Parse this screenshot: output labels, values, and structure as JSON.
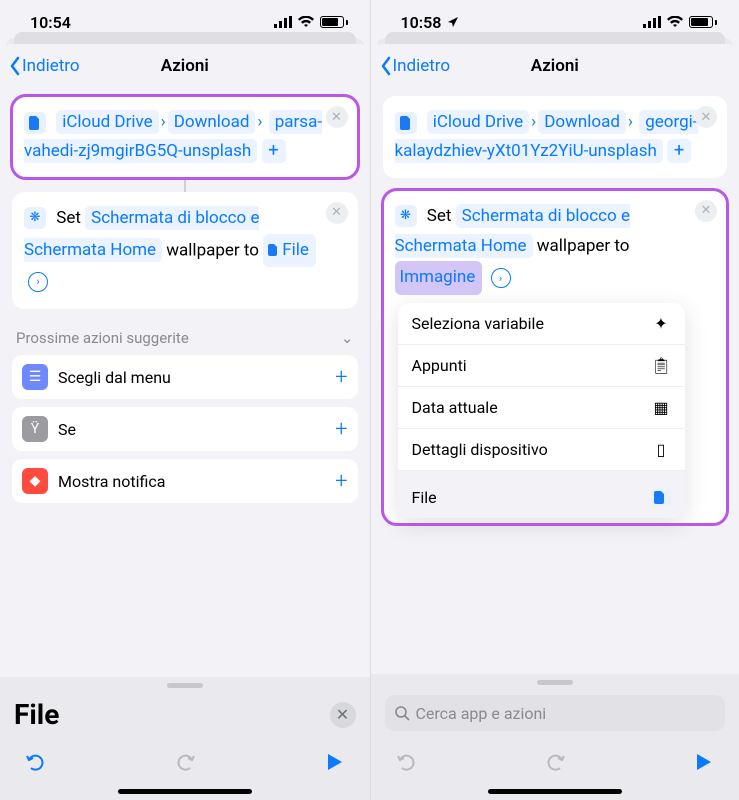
{
  "left": {
    "status": {
      "time": "10:54",
      "battery": "75"
    },
    "nav": {
      "back": "Indietro",
      "title": "Azioni"
    },
    "file_card": {
      "drive": "iCloud Drive",
      "folder": "Download",
      "filename": "parsa-vahedi-zj9mgirBG5Q-unsplash"
    },
    "set_card": {
      "set_word": "Set",
      "target": "Schermata di blocco e Schermata Home",
      "wallpaper_to": "wallpaper to",
      "param_label": "File"
    },
    "suggestions": {
      "header": "Prossime azioni suggerite",
      "items": [
        {
          "label": "Scegli dal menu",
          "color": "#6f87ff",
          "glyph": "☰"
        },
        {
          "label": "Se",
          "color": "#9b9ba0",
          "glyph": "⑂"
        },
        {
          "label": "Mostra notifica",
          "color": "#ff4b3e",
          "glyph": "🔔"
        }
      ]
    },
    "bottom": {
      "big_label": "File"
    }
  },
  "right": {
    "status": {
      "time": "10:58",
      "battery": "74"
    },
    "nav": {
      "back": "Indietro",
      "title": "Azioni"
    },
    "file_card": {
      "drive": "iCloud Drive",
      "folder": "Download",
      "filename": "georgi-kalaydzhiev-yXt01Yz2YiU-unsplash"
    },
    "set_card": {
      "set_word": "Set",
      "target": "Schermata di blocco e Schermata Home",
      "wallpaper_to": "wallpaper to",
      "param_label": "Immagine"
    },
    "popover": {
      "rows": [
        {
          "label": "Seleziona variabile",
          "icon": "wand"
        },
        {
          "label": "Appunti",
          "icon": "clipboard"
        },
        {
          "label": "Data attuale",
          "icon": "calendar"
        },
        {
          "label": "Dettagli dispositivo",
          "icon": "phone"
        },
        {
          "label": "File",
          "icon": "file"
        }
      ]
    },
    "bottom": {
      "search_placeholder": "Cerca app e azioni"
    }
  }
}
